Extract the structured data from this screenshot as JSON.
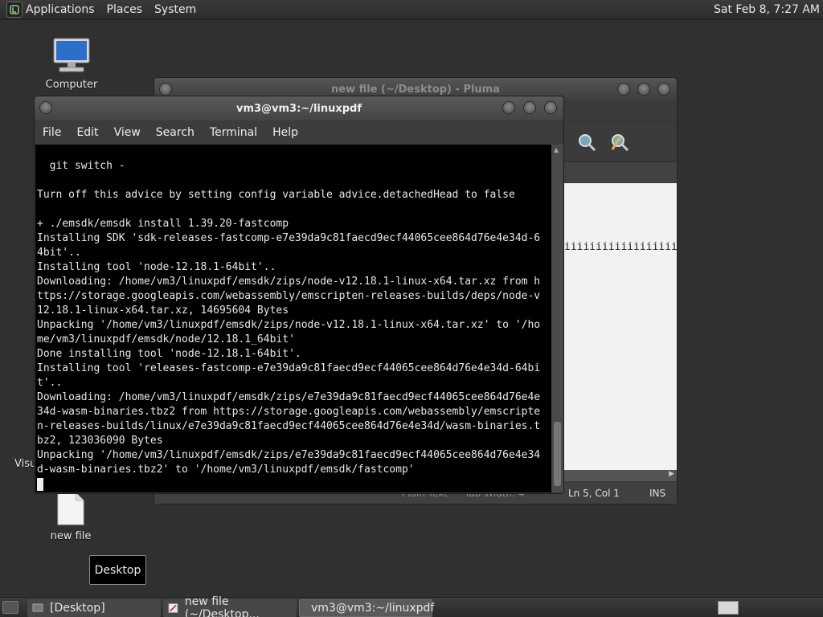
{
  "top_panel": {
    "menus": [
      "Applications",
      "Places",
      "System"
    ],
    "clock": "Sat Feb  8,  7:27 AM"
  },
  "desktop": {
    "icons": [
      {
        "label": "Computer",
        "icon": "computer-icon"
      },
      {
        "label": "Visu",
        "icon": "file-icon"
      },
      {
        "label": "new file",
        "icon": "file-icon"
      }
    ],
    "tooltip": "Desktop"
  },
  "pluma": {
    "title": "new file (~/Desktop) - Pluma",
    "editor_text": "iiiiiiiiiiiiiiiiiiiiii",
    "status": {
      "language": "Plain Text",
      "tab_width": "Tab Width:  4",
      "position": "Ln 5, Col 1",
      "mode": "INS"
    },
    "toolbar_icons": [
      "find-icon",
      "replace-icon"
    ]
  },
  "terminal": {
    "title": "vm3@vm3:~/linuxpdf",
    "menus": [
      "File",
      "Edit",
      "View",
      "Search",
      "Terminal",
      "Help"
    ],
    "lines": [
      "  git switch -",
      "",
      "Turn off this advice by setting config variable advice.detachedHead to false",
      "",
      "+ ./emsdk/emsdk install 1.39.20-fastcomp",
      "Installing SDK 'sdk-releases-fastcomp-e7e39da9c81faecd9ecf44065cee864d76e4e34d-6",
      "4bit'..",
      "Installing tool 'node-12.18.1-64bit'..",
      "Downloading: /home/vm3/linuxpdf/emsdk/zips/node-v12.18.1-linux-x64.tar.xz from h",
      "ttps://storage.googleapis.com/webassembly/emscripten-releases-builds/deps/node-v",
      "12.18.1-linux-x64.tar.xz, 14695604 Bytes",
      "Unpacking '/home/vm3/linuxpdf/emsdk/zips/node-v12.18.1-linux-x64.tar.xz' to '/ho",
      "me/vm3/linuxpdf/emsdk/node/12.18.1_64bit'",
      "Done installing tool 'node-12.18.1-64bit'.",
      "Installing tool 'releases-fastcomp-e7e39da9c81faecd9ecf44065cee864d76e4e34d-64bi",
      "t'..",
      "Downloading: /home/vm3/linuxpdf/emsdk/zips/e7e39da9c81faecd9ecf44065cee864d76e4e",
      "34d-wasm-binaries.tbz2 from https://storage.googleapis.com/webassembly/emscripte",
      "n-releases-builds/linux/e7e39da9c81faecd9ecf44065cee864d76e4e34d/wasm-binaries.t",
      "bz2, 123036090 Bytes",
      "Unpacking '/home/vm3/linuxpdf/emsdk/zips/e7e39da9c81faecd9ecf44065cee864d76e4e34",
      "d-wasm-binaries.tbz2' to '/home/vm3/linuxpdf/emsdk/fastcomp'"
    ]
  },
  "taskbar": {
    "tasks": [
      {
        "label": "[Desktop]",
        "icon": "desktop-icon"
      },
      {
        "label": "new file (~/Desktop...",
        "icon": "text-editor-icon"
      },
      {
        "label": "vm3@vm3:~/linuxpdf",
        "icon": "terminal-icon"
      }
    ]
  }
}
